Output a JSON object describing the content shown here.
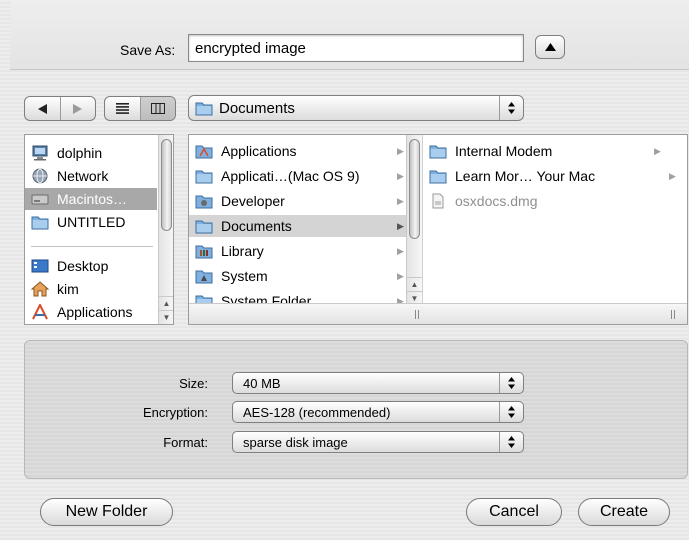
{
  "save_as": {
    "label": "Save As:",
    "value": "encrypted image"
  },
  "location": {
    "current": "Documents"
  },
  "sidebar": {
    "items": [
      {
        "label": "dolphin",
        "icon": "computer-icon"
      },
      {
        "label": "Network",
        "icon": "network-globe-icon"
      },
      {
        "label": "Macintos…",
        "icon": "hard-drive-icon",
        "selected": true
      },
      {
        "label": "UNTITLED",
        "icon": "folder-icon"
      },
      {
        "label": "Desktop",
        "icon": "desktop-icon"
      },
      {
        "label": "kim",
        "icon": "home-icon"
      },
      {
        "label": "Applications",
        "icon": "applications-icon"
      }
    ]
  },
  "browser": {
    "column1": [
      {
        "label": "Applications",
        "icon": "applications-folder-icon"
      },
      {
        "label": "Applicati…(Mac OS 9)",
        "icon": "folder-icon"
      },
      {
        "label": "Developer",
        "icon": "developer-folder-icon"
      },
      {
        "label": "Documents",
        "icon": "folder-icon",
        "selected": true
      },
      {
        "label": "Library",
        "icon": "library-folder-icon"
      },
      {
        "label": "System",
        "icon": "system-folder-icon"
      },
      {
        "label": "System Folder",
        "icon": "folder-icon"
      }
    ],
    "column2": [
      {
        "label": "Internal Modem",
        "icon": "folder-icon"
      },
      {
        "label": "Learn Mor… Your Mac",
        "icon": "folder-icon"
      },
      {
        "label": "osxdocs.dmg",
        "icon": "disk-image-icon",
        "dimmed": true
      }
    ]
  },
  "options": {
    "size": {
      "label": "Size:",
      "value": "40 MB"
    },
    "encryption": {
      "label": "Encryption:",
      "value": "AES-128 (recommended)"
    },
    "format": {
      "label": "Format:",
      "value": "sparse disk image"
    }
  },
  "buttons": {
    "new_folder": "New Folder",
    "cancel": "Cancel",
    "create": "Create"
  }
}
